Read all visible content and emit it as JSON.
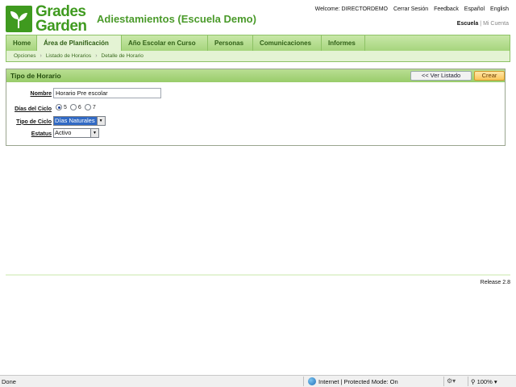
{
  "logo": {
    "line1": "Grades",
    "line2": "Garden"
  },
  "app_title": "Adiestamientos (Escuela Demo)",
  "top_links": {
    "welcome": "Welcome: DIRECTORDEMO",
    "logout": "Cerrar Sesión",
    "feedback": "Feedback",
    "spanish": "Español",
    "english": "English"
  },
  "mode": {
    "active": "Escuela",
    "separator": "|",
    "other": "Mi Cuenta"
  },
  "nav": {
    "items": [
      {
        "label": "Home"
      },
      {
        "label": "Área de Planificación"
      },
      {
        "label": "Año Escolar en Curso"
      },
      {
        "label": "Personas"
      },
      {
        "label": "Comunicaciones"
      },
      {
        "label": "Informes"
      }
    ],
    "active_index": 1
  },
  "breadcrumb": [
    "Opciones",
    "Listado de Horarios",
    "Detalle de Horario"
  ],
  "panel": {
    "title": "Tipo de Horario",
    "list_button": "<< Ver Listado",
    "create_button": "Crear"
  },
  "form": {
    "nombre_label": "Nombre",
    "nombre_value": "Horario Pre escolar",
    "dias_label": "Días del Ciclo",
    "dias_options": [
      "5",
      "6",
      "7"
    ],
    "dias_selected": "5",
    "tipo_label": "Tipo de Ciclo",
    "tipo_value": "Días Naturales",
    "estatus_label": "Estatus",
    "estatus_value": "Activo"
  },
  "release": "Release 2.8",
  "statusbar": {
    "done": "Done",
    "zone": "Internet | Protected Mode: On",
    "zoom": "100%"
  },
  "colors": {
    "brand_green": "#3f9a1f",
    "nav_bg": "#a6d57d",
    "create_orange": "#fac65a"
  }
}
